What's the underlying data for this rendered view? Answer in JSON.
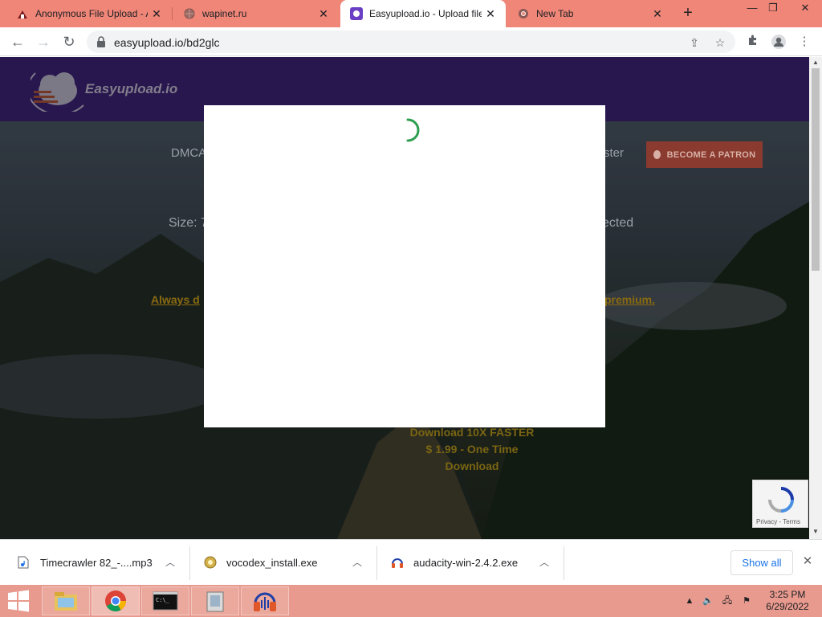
{
  "browser": {
    "tabs": [
      {
        "title": "Anonymous File Upload - A",
        "favicon": "file-upload-favicon"
      },
      {
        "title": "wapinet.ru",
        "favicon": "globe-favicon"
      },
      {
        "title": "Easyupload.io - Upload file",
        "favicon": "easyupload-favicon"
      },
      {
        "title": "New Tab",
        "favicon": "chrome-favicon"
      }
    ],
    "new_tab_glyph": "+",
    "url": "easyupload.io/bd2glc"
  },
  "page": {
    "logo_text": "Easyupload.io",
    "nav_dmca": "DMCA",
    "nav_faster": "ster",
    "patron_button": "BECOME A PATRON",
    "size_text": "Size: 7",
    "protected_text": "ected",
    "always_link": "Always d",
    "premium_link": "premium.",
    "promo_line1": "Download 10X FASTER",
    "promo_line2": "$ 1.99 - One Time",
    "promo_line3": "Download",
    "recaptcha_terms": "Privacy - Terms"
  },
  "downloads": {
    "items": [
      {
        "name": "Timecrawler 82_-....mp3",
        "icon": "audio-file-icon"
      },
      {
        "name": "vocodex_install.exe",
        "icon": "installer-icon"
      },
      {
        "name": "audacity-win-2.4.2.exe",
        "icon": "audacity-icon"
      }
    ],
    "show_all": "Show all"
  },
  "taskbar": {
    "time": "3:25 PM",
    "date": "6/29/2022"
  },
  "colors": {
    "tab_strip": "#f08678",
    "header_purple": "#3e2378",
    "spinner_green": "#2e9e4f",
    "taskbar": "#e89a8e"
  }
}
